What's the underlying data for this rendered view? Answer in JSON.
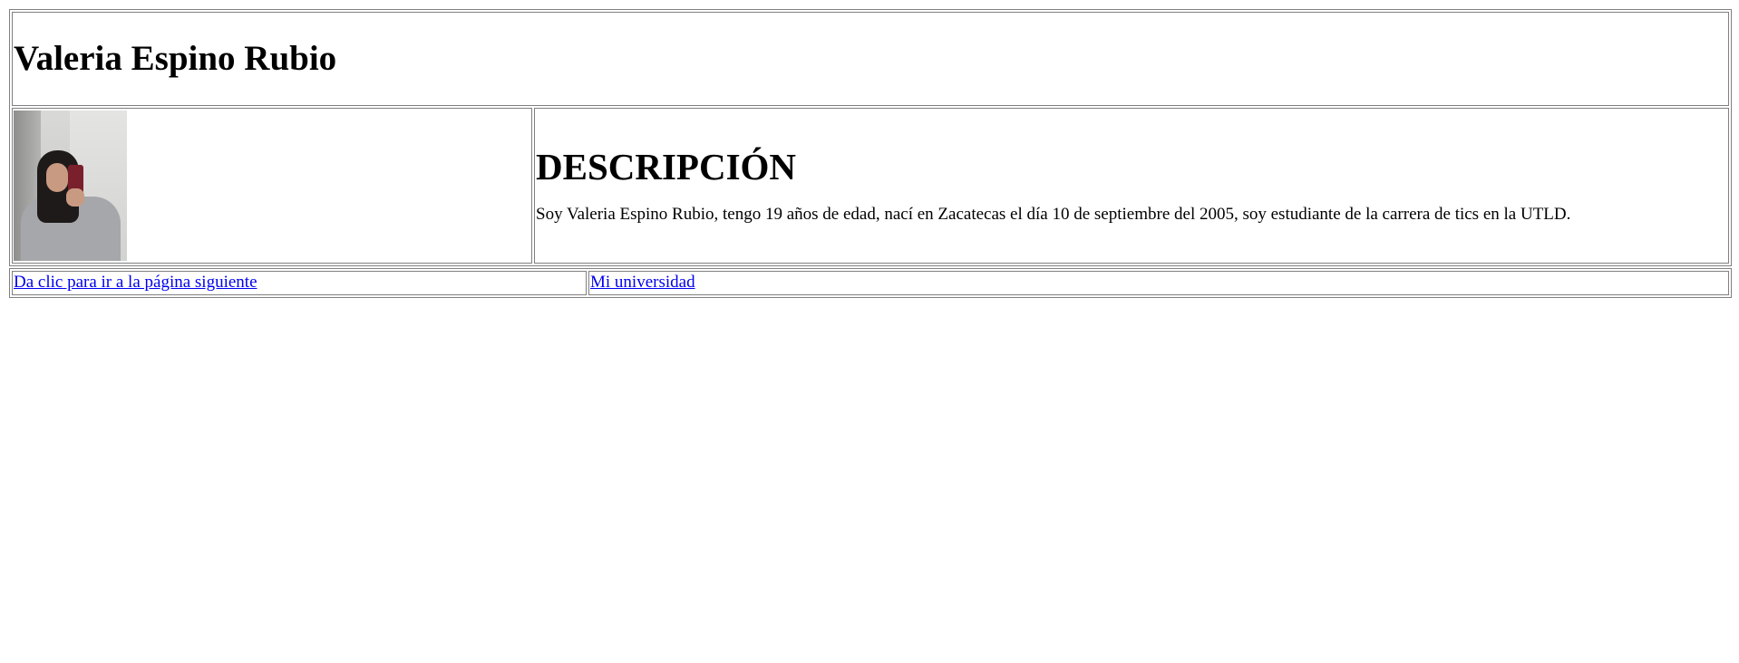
{
  "header": {
    "name": "Valeria Espino Rubio"
  },
  "photo": {
    "alt": "Foto de Valeria Espino Rubio"
  },
  "description": {
    "heading": "DESCRIPCIÓN",
    "text": "Soy Valeria Espino Rubio, tengo 19 años de edad, nací en Zacatecas el día 10 de septiembre del 2005, soy estudiante de la carrera de tics en la UTLD."
  },
  "links": {
    "next_page": "Da clic para ir a la página siguiente",
    "university": "Mi universidad"
  },
  "colors": {
    "link": "#0000ee",
    "border": "#808080",
    "background": "#ffffff"
  }
}
